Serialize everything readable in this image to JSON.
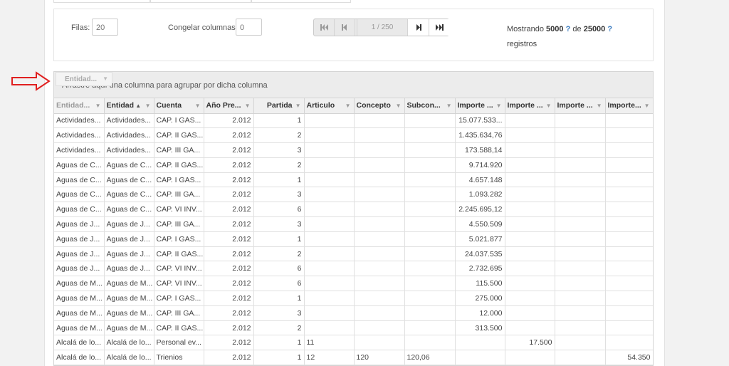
{
  "toolbar": {
    "rows_label": "Filas:",
    "rows_value": "20",
    "freeze_label": "Congelar columnas",
    "freeze_value": "0",
    "page_indicator": "1 / 250",
    "showing_prefix": "Mostrando",
    "showing_count": "5000",
    "showing_of": "de",
    "showing_total": "25000",
    "help_mark": "?",
    "showing_suffix": "registros"
  },
  "pager_icons": [
    "first-page-icon",
    "prev-page-icon",
    "next-page-icon",
    "last-page-icon"
  ],
  "group_bar": {
    "hint": "Arrastre aquí una columna para agrupar por dicha columna",
    "dragged_chip": "Entidad..."
  },
  "columns": [
    "Entidad...",
    "Entidad",
    "Cuenta",
    "Año Pre...",
    "Partida",
    "Articulo",
    "Concepto",
    "Subcon...",
    "Importe ...",
    "Importe ...",
    "Importe ...",
    "Importe..."
  ],
  "sorted_column": "Entidad",
  "rows": [
    [
      "Actividades...",
      "Actividades...",
      "CAP. I GAS...",
      "2.012",
      "1",
      "",
      "",
      "",
      "15.077.533...",
      "",
      "",
      ""
    ],
    [
      "Actividades...",
      "Actividades...",
      "CAP. II GAS...",
      "2.012",
      "2",
      "",
      "",
      "",
      "1.435.634,76",
      "",
      "",
      ""
    ],
    [
      "Actividades...",
      "Actividades...",
      "CAP. III GA...",
      "2.012",
      "3",
      "",
      "",
      "",
      "173.588,14",
      "",
      "",
      ""
    ],
    [
      "Aguas de C...",
      "Aguas de C...",
      "CAP. II GAS...",
      "2.012",
      "2",
      "",
      "",
      "",
      "9.714.920",
      "",
      "",
      ""
    ],
    [
      "Aguas de C...",
      "Aguas de C...",
      "CAP. I GAS...",
      "2.012",
      "1",
      "",
      "",
      "",
      "4.657.148",
      "",
      "",
      ""
    ],
    [
      "Aguas de C...",
      "Aguas de C...",
      "CAP. III GA...",
      "2.012",
      "3",
      "",
      "",
      "",
      "1.093.282",
      "",
      "",
      ""
    ],
    [
      "Aguas de C...",
      "Aguas de C...",
      "CAP. VI INV...",
      "2.012",
      "6",
      "",
      "",
      "",
      "2.245.695,12",
      "",
      "",
      ""
    ],
    [
      "Aguas de J...",
      "Aguas de J...",
      "CAP. III GA...",
      "2.012",
      "3",
      "",
      "",
      "",
      "4.550.509",
      "",
      "",
      ""
    ],
    [
      "Aguas de J...",
      "Aguas de J...",
      "CAP. I GAS...",
      "2.012",
      "1",
      "",
      "",
      "",
      "5.021.877",
      "",
      "",
      ""
    ],
    [
      "Aguas de J...",
      "Aguas de J...",
      "CAP. II GAS...",
      "2.012",
      "2",
      "",
      "",
      "",
      "24.037.535",
      "",
      "",
      ""
    ],
    [
      "Aguas de J...",
      "Aguas de J...",
      "CAP. VI INV...",
      "2.012",
      "6",
      "",
      "",
      "",
      "2.732.695",
      "",
      "",
      ""
    ],
    [
      "Aguas de M...",
      "Aguas de M...",
      "CAP. VI INV...",
      "2.012",
      "6",
      "",
      "",
      "",
      "115.500",
      "",
      "",
      ""
    ],
    [
      "Aguas de M...",
      "Aguas de M...",
      "CAP. I GAS...",
      "2.012",
      "1",
      "",
      "",
      "",
      "275.000",
      "",
      "",
      ""
    ],
    [
      "Aguas de M...",
      "Aguas de M...",
      "CAP. III GA...",
      "2.012",
      "3",
      "",
      "",
      "",
      "12.000",
      "",
      "",
      ""
    ],
    [
      "Aguas de M...",
      "Aguas de M...",
      "CAP. II GAS...",
      "2.012",
      "2",
      "",
      "",
      "",
      "313.500",
      "",
      "",
      ""
    ],
    [
      "Alcalá de lo...",
      "Alcalá de lo...",
      "Personal ev...",
      "2.012",
      "1",
      "11",
      "",
      "",
      "",
      "17.500",
      "",
      ""
    ],
    [
      "Alcalá de lo...",
      "Alcalá de lo...",
      "Trienios",
      "2.012",
      "1",
      "12",
      "120",
      "120,06",
      "",
      "",
      "",
      "54.350"
    ]
  ],
  "colors": {
    "arrow": "#e02020",
    "link": "#3a7bbf"
  }
}
